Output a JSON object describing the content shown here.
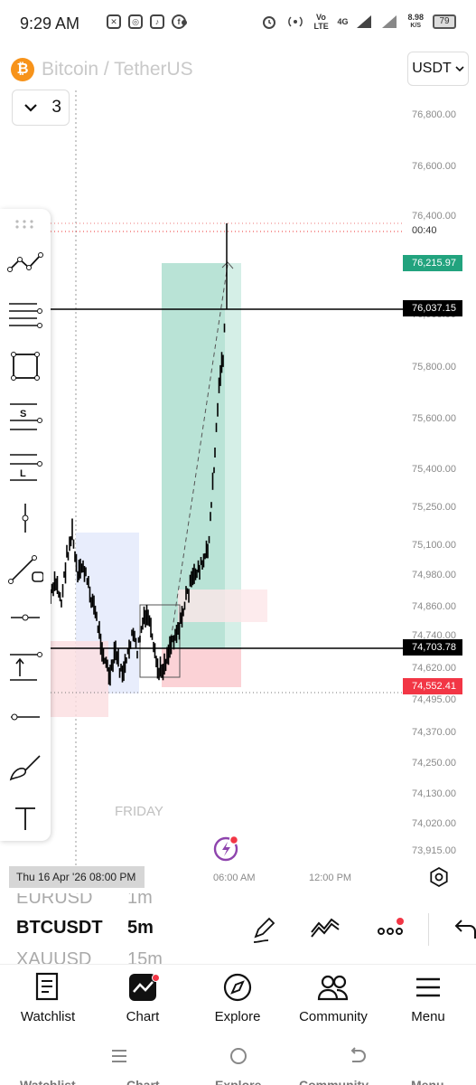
{
  "status_bar": {
    "time": "9:29 AM",
    "net_type": "Vo LTE",
    "net_gen": "4G",
    "speed_value": "8.98",
    "speed_unit": "K/S",
    "battery": "79"
  },
  "header": {
    "symbol_name": "Bitcoin / TetherUS",
    "logo_glyph": "₿",
    "quote_currency": "USDT",
    "collapse_value": "3"
  },
  "price_axis": {
    "ticks": [
      "76,800.00",
      "76,600.00",
      "76,400.00",
      "76,000.00",
      "75,800.00",
      "75,600.00",
      "75,400.00",
      "75,250.00",
      "75,100.00",
      "74,980.00",
      "74,860.00",
      "74,740.00",
      "74,620.00",
      "74,495.00",
      "74,370.00",
      "74,250.00",
      "74,130.00",
      "74,020.00",
      "73,915.00"
    ],
    "take_profit_tag": "76,215.97",
    "current_price_tag": "76,037.15",
    "entry_tag": "74,703.78",
    "stop_loss_tag": "74,552.41",
    "countdown": "00:40"
  },
  "chart": {
    "day_label": "FRIDAY",
    "colors": {
      "profit_zone": "#b9e3d6",
      "loss_zone": "#fbdde0",
      "blue_zone": "#e4eafc",
      "candles": "#000000"
    }
  },
  "time_axis": {
    "crosshair_date": "Thu 16 Apr '26   08:00 PM",
    "ticks": [
      "06:00 AM",
      "12:00 PM"
    ]
  },
  "bottom_strip": {
    "prev_symbol": "EURUSD",
    "prev_interval": "1m",
    "current_symbol": "BTCUSDT",
    "current_interval": "5m",
    "next_symbol": "XAUUSD",
    "next_interval": "15m"
  },
  "tab_bar": {
    "tabs": [
      {
        "label": "Watchlist",
        "icon": "watchlist-icon"
      },
      {
        "label": "Chart",
        "icon": "chart-icon"
      },
      {
        "label": "Explore",
        "icon": "compass-icon"
      },
      {
        "label": "Community",
        "icon": "community-icon"
      },
      {
        "label": "Menu",
        "icon": "hamburger-icon"
      }
    ]
  }
}
